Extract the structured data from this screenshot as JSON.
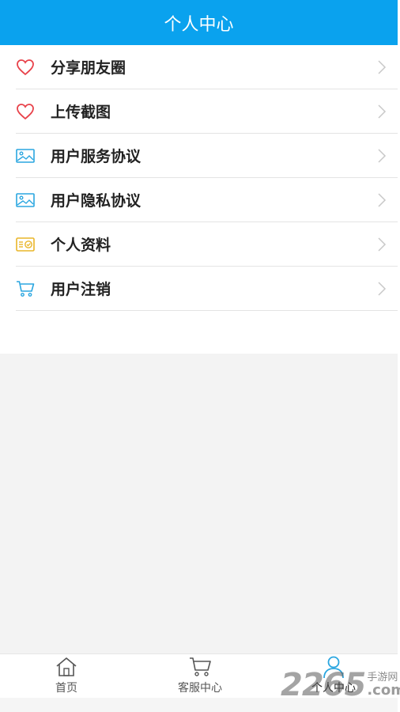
{
  "header": {
    "title": "个人中心"
  },
  "menu": {
    "items": [
      {
        "label": "分享朋友圈",
        "icon": "heart-icon",
        "color": "#e8424a"
      },
      {
        "label": "上传截图",
        "icon": "heart-icon",
        "color": "#e8424a"
      },
      {
        "label": "用户服务协议",
        "icon": "image-icon",
        "color": "#2aa6e0"
      },
      {
        "label": "用户隐私协议",
        "icon": "image-icon",
        "color": "#2aa6e0"
      },
      {
        "label": "个人资料",
        "icon": "id-card-icon",
        "color": "#e9b528"
      },
      {
        "label": "用户注销",
        "icon": "cart-icon",
        "color": "#2aa6e0"
      }
    ]
  },
  "bottom_nav": {
    "items": [
      {
        "label": "首页",
        "icon": "home-icon"
      },
      {
        "label": "客服中心",
        "icon": "cart-icon"
      },
      {
        "label": "个人中心",
        "icon": "person-icon",
        "active": true
      }
    ]
  },
  "watermark": {
    "big": "2265",
    "top": "手游网",
    "bottom": ".com"
  },
  "colors": {
    "accent": "#0aa2ee",
    "background": "#f3f3f3"
  }
}
